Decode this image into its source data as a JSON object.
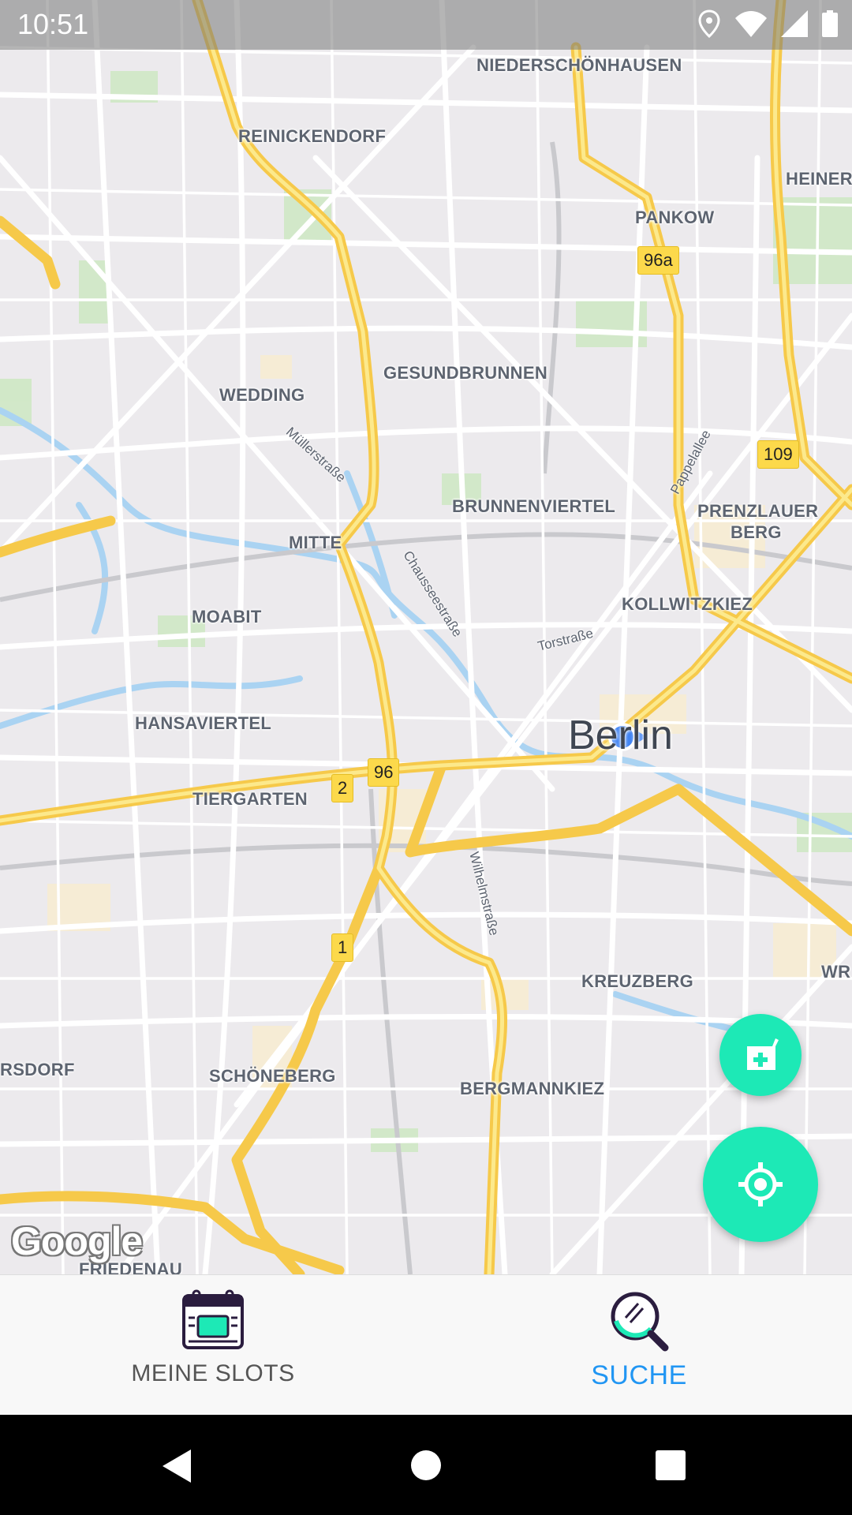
{
  "status_bar": {
    "time": "10:51",
    "icons": [
      "location-icon",
      "wifi-icon",
      "signal-icon",
      "battery-icon"
    ]
  },
  "map": {
    "district_labels": [
      "NIEDERSCHÖNHAUSEN",
      "REINICKENDORF",
      "HEINERS",
      "PANKOW",
      "GESUNDBRUNNEN",
      "WEDDING",
      "BRUNNENVIERTEL",
      "PRENZLAUER",
      "BERG",
      "MITTE",
      "KOLLWITZKIEZ",
      "MOABIT",
      "HANSAVIERTEL",
      "TIERGARTEN",
      "KREUZBERG",
      "WR",
      "RSDORF",
      "SCHÖNEBERG",
      "BERGMANNKIEZ",
      "FRIEDENAU"
    ],
    "street_labels": [
      "Müllerstraße",
      "Chausseestraße",
      "Pappelallee",
      "Torstraße",
      "Wilhelmstraße"
    ],
    "city_label": "Berlin",
    "route_shields": [
      "96a",
      "109",
      "96",
      "2",
      "1"
    ],
    "attribution": "Google"
  },
  "fabs": {
    "add_pharmacy_icon": "pharmacy-add-icon",
    "my_location_icon": "my-location-icon"
  },
  "bottom_nav": {
    "items": [
      {
        "label": "MEINE SLOTS",
        "icon": "calendar-slots-icon",
        "active": false
      },
      {
        "label": "SUCHE",
        "icon": "search-magnifier-icon",
        "active": true
      }
    ],
    "active_color": "#2196f3",
    "inactive_color": "#555555"
  },
  "colors": {
    "fab": "#1de9b6",
    "highway": "#fcd94b",
    "location_dot": "#4285f4"
  }
}
